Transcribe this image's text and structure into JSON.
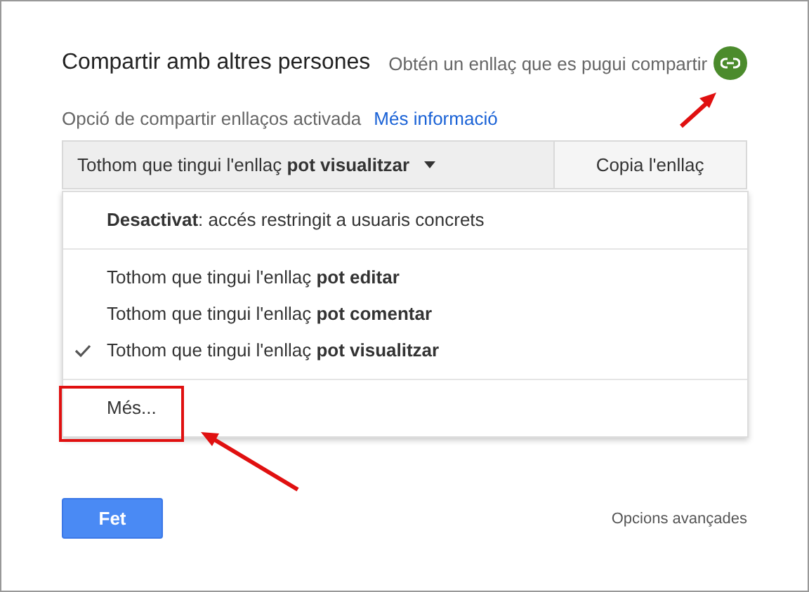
{
  "dialog": {
    "title": "Compartir amb altres persones",
    "share_hint": "Obtén un enllaç que es pugui compartir"
  },
  "status": {
    "text": "Opció de compartir enllaços activada",
    "link": "Més informació"
  },
  "access_dropdown": {
    "value": "Tothom que tingui l'enllaç **pot visualitzar**"
  },
  "copy_button": "Copia l'enllaç",
  "menu_sections": [
    {
      "items": [
        {
          "label": "**Desactivat**: accés restringit a usuaris concrets",
          "selected": false
        }
      ]
    },
    {
      "items": [
        {
          "label": "Tothom que tingui l'enllaç **pot editar**",
          "selected": false
        },
        {
          "label": "Tothom que tingui l'enllaç **pot comentar**",
          "selected": false
        },
        {
          "label": "Tothom que tingui l'enllaç **pot visualitzar**",
          "selected": true
        }
      ]
    },
    {
      "items": [
        {
          "label": "Més...",
          "selected": false
        }
      ]
    }
  ],
  "done_button": "Fet",
  "advanced_link": "Opcions avançades"
}
